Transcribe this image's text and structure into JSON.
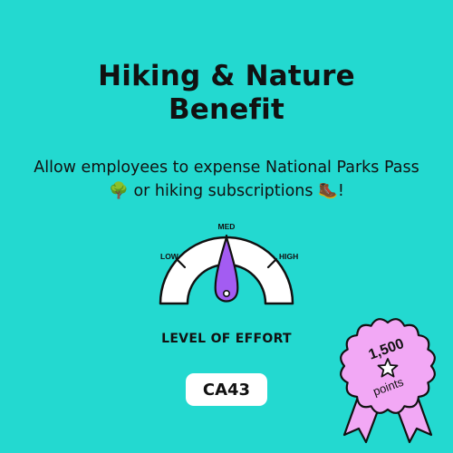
{
  "colors": {
    "background": "#23d9d0",
    "gauge_fill": "#ffffff",
    "needle": "#a35cf2",
    "rosette": "#f2a8f5",
    "text": "#111111"
  },
  "title": {
    "line1": "Hiking & Nature",
    "line2": "Benefit"
  },
  "subtitle": {
    "text_a": "Allow employees to expense National Parks Pass ",
    "emoji_a": "🌳",
    "text_b": " or hiking subscriptions ",
    "emoji_b": "🥾",
    "text_c": "!"
  },
  "gauge": {
    "labels": {
      "low": "LOW",
      "med": "MED",
      "high": "HIGH"
    },
    "level": "MED",
    "caption": "LEVEL OF EFFORT"
  },
  "code": "CA43",
  "reward": {
    "points_value": "1,500",
    "points_unit": "points",
    "icon": "star-icon"
  }
}
